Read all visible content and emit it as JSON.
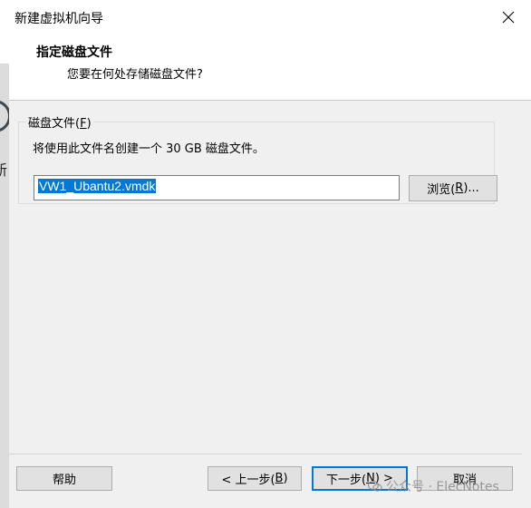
{
  "window": {
    "title": "新建虚拟机向导",
    "close_glyph": "✕"
  },
  "header": {
    "title": "指定磁盘文件",
    "subtitle": "您要在何处存储磁盘文件?"
  },
  "disk_file": {
    "group_label": "磁盘文件(",
    "group_hotkey": "F",
    "group_label_end": ")",
    "description": "将使用此文件名创建一个 30 GB 磁盘文件。",
    "path_value": "VW1_Ubantu2.vmdk",
    "browse_label": "浏览(",
    "browse_hotkey": "R",
    "browse_label_end": ")..."
  },
  "background": {
    "partial_char": "新"
  },
  "footer": {
    "help_label": "帮助",
    "back_label": "< 上一步(",
    "back_hotkey": "B",
    "back_label_end": ")",
    "next_label": "下一步(",
    "next_hotkey": "N",
    "next_label_end": ") >",
    "cancel_label": "取消"
  },
  "watermark": {
    "text": "公众号 · ElecNotes"
  },
  "colors": {
    "selection": "#0078d7",
    "window_bg": "#f0f0f0",
    "header_bg": "#ffffff"
  }
}
